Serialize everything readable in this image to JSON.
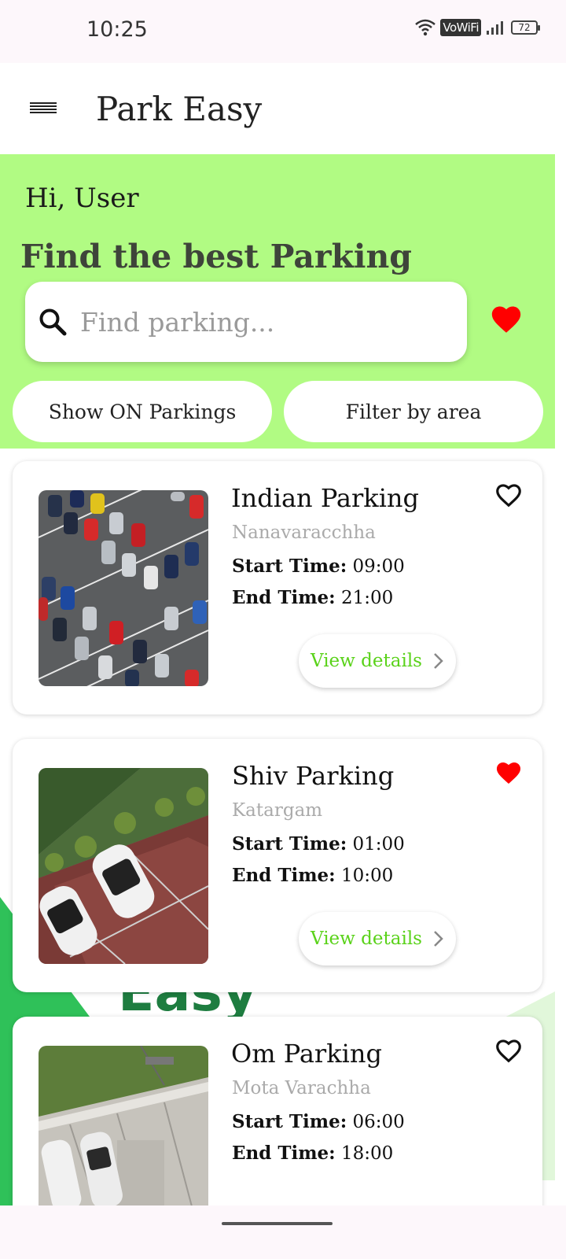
{
  "status_bar": {
    "time": "10:25",
    "network": "VoWiFi",
    "battery": "72"
  },
  "app_bar": {
    "title": "Park Easy",
    "menu_icon": "menu-icon"
  },
  "hero": {
    "greeting": "Hi, User",
    "title": "Find the best Parking",
    "search": {
      "placeholder": "Find parking...",
      "value": ""
    },
    "favorites_icon": "heart-filled-icon",
    "filter_buttons": {
      "show_on": "Show ON Parkings",
      "filter_area": "Filter by area"
    }
  },
  "background_text": "Easy",
  "parkings": [
    {
      "name": "Indian Parking",
      "area": "Nanavaracchha",
      "start_label": "Start Time:",
      "start_time": "09:00",
      "end_label": "End Time:",
      "end_time": "21:00",
      "favorite": false,
      "details_label": "View details"
    },
    {
      "name": "Shiv Parking",
      "area": "Katargam",
      "start_label": "Start Time:",
      "start_time": "01:00",
      "end_label": "End Time:",
      "end_time": "10:00",
      "favorite": true,
      "details_label": "View details"
    },
    {
      "name": "Om Parking",
      "area": "Mota Varachha",
      "start_label": "Start Time:",
      "start_time": "06:00",
      "end_label": "End Time:",
      "end_time": "18:00",
      "favorite": false,
      "details_label": "View details"
    }
  ],
  "colors": {
    "hero_bg": "#b1fb83",
    "accent_green": "#5ad21a",
    "heart_red": "#ff0000"
  }
}
